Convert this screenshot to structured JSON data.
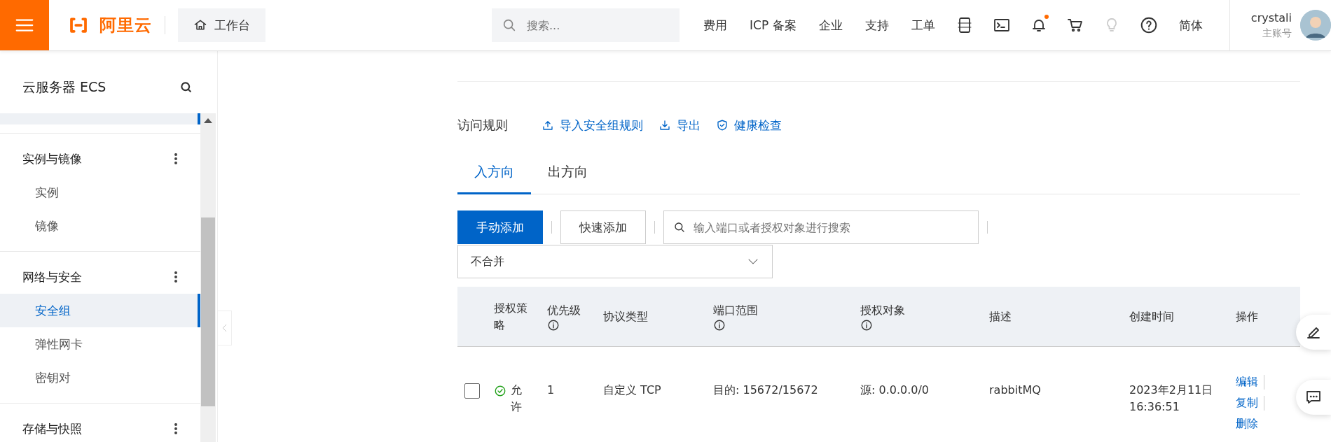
{
  "top_bar": {
    "logo": "阿里云",
    "workbench": "工作台",
    "search": {
      "placeholder": "搜索..."
    },
    "nav_links": [
      "费用",
      "ICP 备案",
      "企业",
      "支持",
      "工单"
    ],
    "bell_badge": true,
    "language": "简体",
    "user": {
      "name": "crystali",
      "role": "主账号"
    }
  },
  "sidebar": {
    "title": "云服务器 ECS",
    "groups": [
      {
        "label": "实例与镜像",
        "items": [
          {
            "label": "实例",
            "selected": false
          },
          {
            "label": "镜像",
            "selected": false
          }
        ]
      },
      {
        "label": "网络与安全",
        "items": [
          {
            "label": "安全组",
            "selected": true
          },
          {
            "label": "弹性网卡",
            "selected": false
          },
          {
            "label": "密钥对",
            "selected": false
          }
        ]
      },
      {
        "label": "存储与快照"
      }
    ]
  },
  "main": {
    "section_title": "访问规则",
    "actions": [
      {
        "label": "导入安全组规则",
        "kind": "upload"
      },
      {
        "label": "导出",
        "kind": "download"
      },
      {
        "label": "健康检查",
        "kind": "shield"
      }
    ],
    "tabs": [
      {
        "label": "入方向",
        "selected": true
      },
      {
        "label": "出方向",
        "selected": false
      }
    ],
    "toolbar": [
      {
        "label": "手动添加",
        "kind": "primary"
      },
      {
        "label": "快速添加",
        "kind": "secondary"
      }
    ],
    "rule_search": {
      "placeholder": "输入端口或者授权对象进行搜索"
    },
    "merge_select": {
      "value": "不合并"
    },
    "table": {
      "columns": [
        {
          "label": "授权策略",
          "info": false
        },
        {
          "label": "优先级",
          "info": true
        },
        {
          "label": "协议类型",
          "info": false
        },
        {
          "label": "端口范围",
          "info": true
        },
        {
          "label": "授权对象",
          "info": true
        },
        {
          "label": "描述",
          "info": false
        },
        {
          "label": "创建时间",
          "info": false
        },
        {
          "label": "操作",
          "info": false
        }
      ],
      "rows": [
        {
          "checked": false,
          "policy": "允许",
          "priority": "1",
          "protocol": "自定义 TCP",
          "port_range": "目的: 15672/15672",
          "source": "源: 0.0.0.0/0",
          "description": "rabbitMQ",
          "created": "2023年2月11日 16:36:51",
          "actions": [
            "编辑",
            "复制",
            "删除"
          ]
        }
      ]
    }
  }
}
